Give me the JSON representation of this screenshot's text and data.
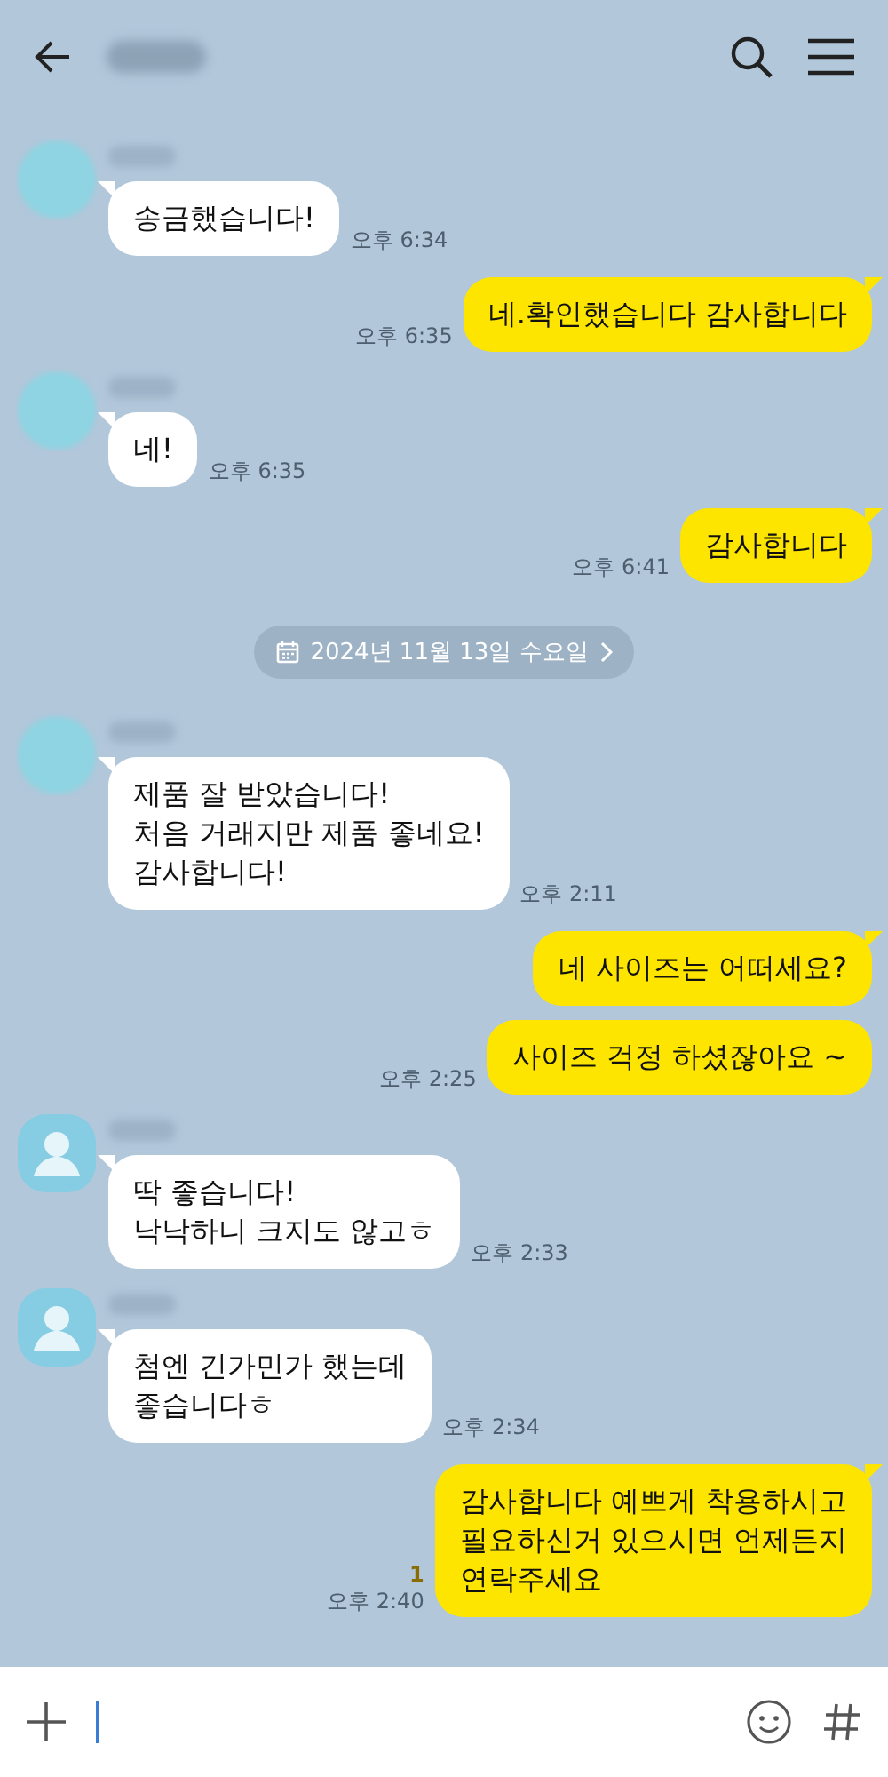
{
  "messages": [
    {
      "kind": "incoming",
      "avatar": {
        "kind": "plain"
      },
      "tail": true,
      "lines": [
        "송금했습니다!"
      ],
      "time": "오후 6:34"
    },
    {
      "kind": "outgoing",
      "tail": true,
      "lines": [
        "네.확인했습니다 감사합니다"
      ],
      "time": "오후 6:35"
    },
    {
      "kind": "incoming",
      "avatar": {
        "kind": "plain"
      },
      "tail": true,
      "lines": [
        "네!"
      ],
      "time": "오후 6:35"
    },
    {
      "kind": "outgoing",
      "tail": true,
      "lines": [
        "감사합니다"
      ],
      "time": "오후 6:41"
    },
    {
      "kind": "date",
      "label": "2024년 11월 13일 수요일"
    },
    {
      "kind": "incoming",
      "avatar": {
        "kind": "plain"
      },
      "tail": true,
      "lines": [
        "제품 잘 받았습니다!",
        "처음 거래지만 제품 좋네요!",
        "감사합니다!"
      ],
      "time": "오후 2:11"
    },
    {
      "kind": "outgoing",
      "tail": true,
      "lines": [
        "네 사이즈는 어떠세요?"
      ]
    },
    {
      "kind": "outgoing",
      "tail": false,
      "lines": [
        "사이즈 걱정 하셨잖아요 ~"
      ],
      "time": "오후 2:25"
    },
    {
      "kind": "incoming",
      "avatar": {
        "kind": "person"
      },
      "tail": true,
      "lines": [
        "딱 좋습니다!",
        "낙낙하니 크지도 않고ㅎ"
      ],
      "time": "오후 2:33"
    },
    {
      "kind": "incoming",
      "avatar": {
        "kind": "person"
      },
      "tail": true,
      "lines": [
        "첨엔 긴가민가 했는데",
        "좋습니다ㅎ"
      ],
      "time": "오후 2:34"
    },
    {
      "kind": "outgoing",
      "tail": true,
      "lines": [
        "감사합니다 예쁘게 착용하시고",
        "필요하신거 있으시면 언제든지",
        "연락주세요"
      ],
      "unread": "1",
      "time": "오후 2:40"
    }
  ]
}
